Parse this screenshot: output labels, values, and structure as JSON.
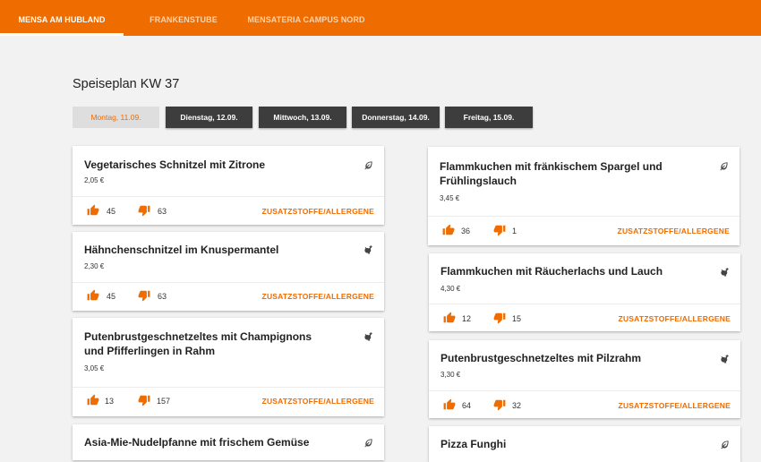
{
  "tabs": [
    {
      "label": "MENSA AM HUBLAND",
      "active": true
    },
    {
      "label": "FRANKENSTUBE",
      "active": false
    },
    {
      "label": "MENSATERIA CAMPUS NORD",
      "active": false
    }
  ],
  "heading": "Speiseplan KW 37",
  "days": [
    "Montag, 11.09.",
    "Dienstag, 12.09.",
    "Mittwoch, 13.09.",
    "Donnerstag, 14.09.",
    "Freitag, 15.09."
  ],
  "allergen_label": "ZUSATZSTOFFE/ALLERGENE",
  "left_meals": [
    {
      "title": "Vegetarisches Schnitzel mit Zitrone",
      "price": "2,05 €",
      "likes": "45",
      "dislikes": "63",
      "icon": "leaf-icon"
    },
    {
      "title": "Hähnchenschnitzel im Knuspermantel",
      "price": "2,30 €",
      "likes": "45",
      "dislikes": "63",
      "icon": "chicken-icon"
    },
    {
      "title": "Putenbrustgeschnetzeltes mit Champignons und Pfifferlingen in Rahm",
      "price": "3,05 €",
      "likes": "13",
      "dislikes": "157",
      "icon": "chicken-icon"
    },
    {
      "title": "Asia-Mie-Nudelpfanne mit frischem Gemüse",
      "icon": "leaf-icon"
    }
  ],
  "right_meals": [
    {
      "title": "Flammkuchen mit fränkischem Spargel und Frühlingslauch",
      "price": "3,45 €",
      "likes": "36",
      "dislikes": "1",
      "icon": "leaf-icon"
    },
    {
      "title": "Flammkuchen mit Räucherlachs und Lauch",
      "price": "4,30 €",
      "likes": "12",
      "dislikes": "15",
      "icon": "chicken-icon"
    },
    {
      "title": "Putenbrustgeschnetzeltes mit Pilzrahm",
      "price": "3,30 €",
      "likes": "64",
      "dislikes": "32",
      "icon": "chicken-icon"
    },
    {
      "title": "Pizza Funghi",
      "icon": "leaf-icon"
    }
  ],
  "colors": {
    "accent": "#ef6c00",
    "day_button": "#3d3d3d",
    "day_active": "#dedede"
  }
}
